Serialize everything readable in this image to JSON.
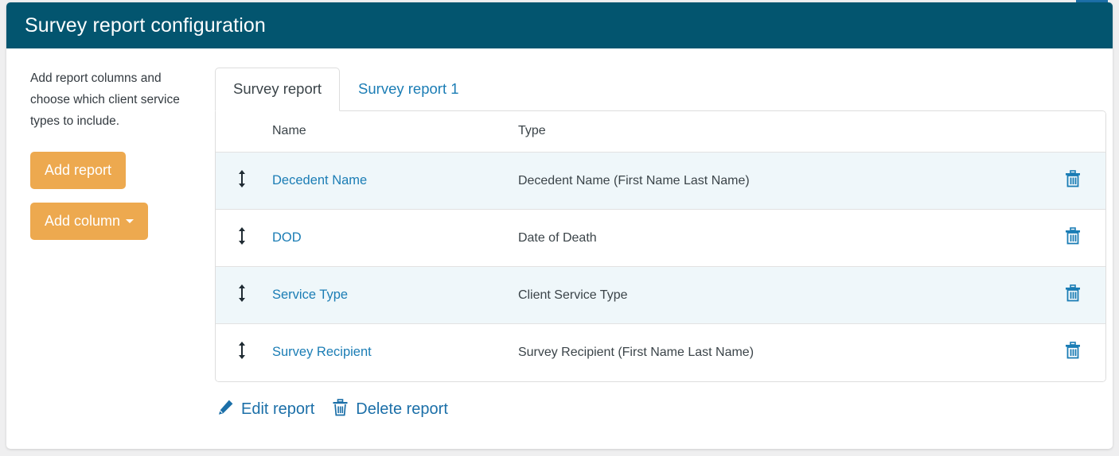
{
  "colors": {
    "header_bg": "#03556f",
    "accent_orange": "#eda94f",
    "link_blue": "#1b7db5",
    "row_shade": "#eff7fa",
    "page_bg": "#efeff0"
  },
  "header": {
    "title": "Survey report configuration"
  },
  "sidebar": {
    "description": "Add report columns and choose which client service types to include.",
    "add_report_label": "Add report",
    "add_column_label": "Add column",
    "add_column_caret_icon": "chevron-down-icon"
  },
  "tabs": [
    {
      "label": "Survey report",
      "active": true
    },
    {
      "label": "Survey report 1",
      "active": false
    }
  ],
  "table": {
    "columns": [
      "Name",
      "Type"
    ],
    "handle_icon": "drag-handle-updown-icon",
    "delete_icon": "trash-icon",
    "rows": [
      {
        "name": "Decedent Name",
        "type": "Decedent Name (First Name Last Name)"
      },
      {
        "name": "DOD",
        "type": "Date of Death"
      },
      {
        "name": "Service Type",
        "type": "Client Service Type"
      },
      {
        "name": "Survey Recipient",
        "type": "Survey Recipient (First Name Last Name)"
      }
    ]
  },
  "actions": {
    "edit_label": "Edit report",
    "edit_icon": "pencil-icon",
    "delete_label": "Delete report",
    "delete_icon": "trash-icon"
  }
}
